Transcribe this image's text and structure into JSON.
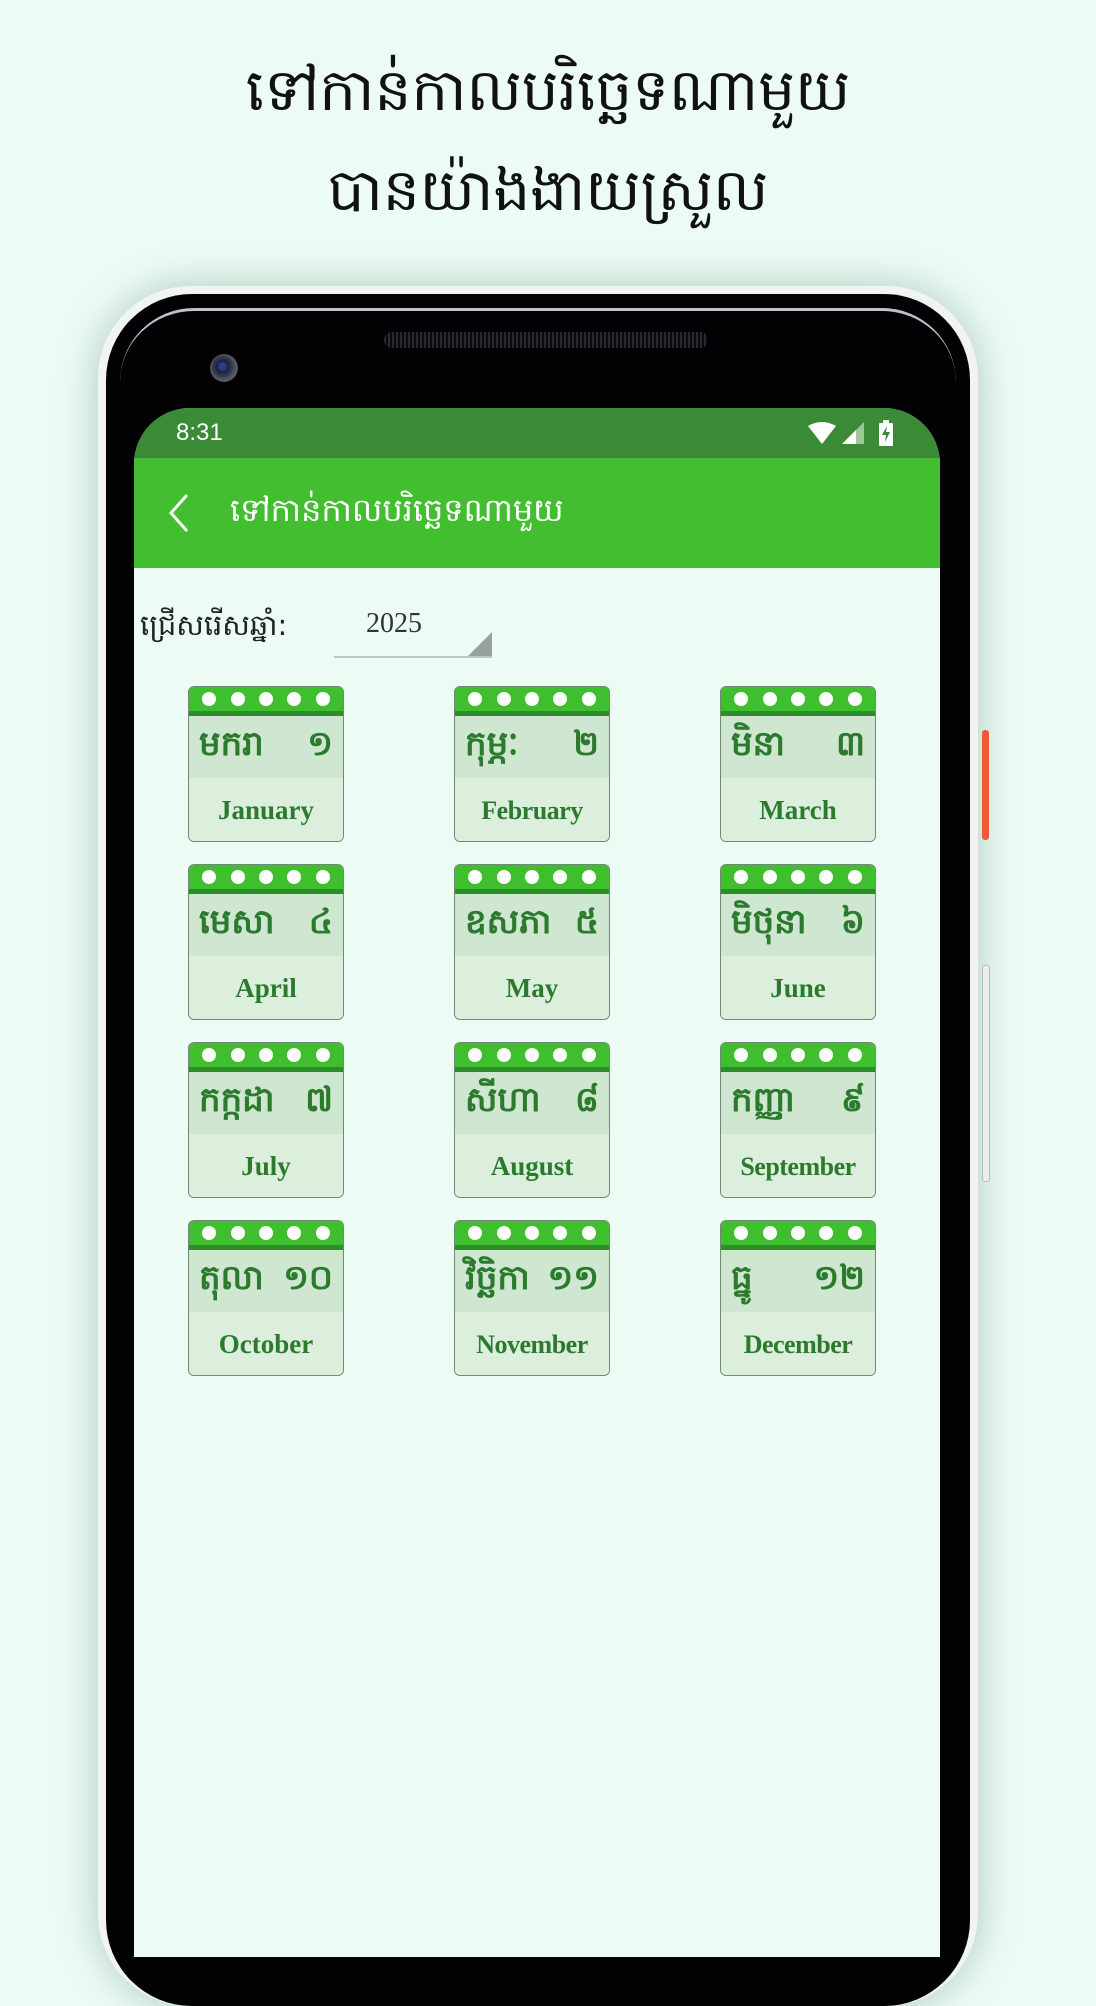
{
  "promo": {
    "line1": "ទៅកាន់កាលបរិច្ឆេទណាមួយ",
    "line2": "បានយ៉ាងងាយស្រួល"
  },
  "statusbar": {
    "time": "8:31",
    "icons": [
      "wifi-icon",
      "cellular-signal-icon",
      "battery-charging-icon"
    ]
  },
  "appbar": {
    "back_icon": "chevron-left-icon",
    "title": "ទៅកាន់កាលបរិច្ឆេទណាមួយ"
  },
  "year_picker": {
    "label": "ជ្រើសរើសឆ្នាំ:",
    "value": "2025"
  },
  "months": [
    {
      "khmer": "មករា",
      "khmer_number": "១",
      "english": "January"
    },
    {
      "khmer": "កុម្ភៈ",
      "khmer_number": "២",
      "english": "February"
    },
    {
      "khmer": "មិនា",
      "khmer_number": "៣",
      "english": "March"
    },
    {
      "khmer": "មេសា",
      "khmer_number": "៤",
      "english": "April"
    },
    {
      "khmer": "ឧសភា",
      "khmer_number": "៥",
      "english": "May"
    },
    {
      "khmer": "មិថុនា",
      "khmer_number": "៦",
      "english": "June"
    },
    {
      "khmer": "កក្កដា",
      "khmer_number": "៧",
      "english": "July"
    },
    {
      "khmer": "សីហា",
      "khmer_number": "៨",
      "english": "August"
    },
    {
      "khmer": "កញ្ញា",
      "khmer_number": "៩",
      "english": "September"
    },
    {
      "khmer": "តុលា",
      "khmer_number": "១០",
      "english": "October"
    },
    {
      "khmer": "វិច្ឆិកា",
      "khmer_number": "១១",
      "english": "November"
    },
    {
      "khmer": "ធ្នូ",
      "khmer_number": "១២",
      "english": "December"
    }
  ],
  "colors": {
    "statusbar": "#3a8a36",
    "appbar": "#43be30",
    "tile_text": "#2b7a2e",
    "background": "#ecfcf4"
  }
}
